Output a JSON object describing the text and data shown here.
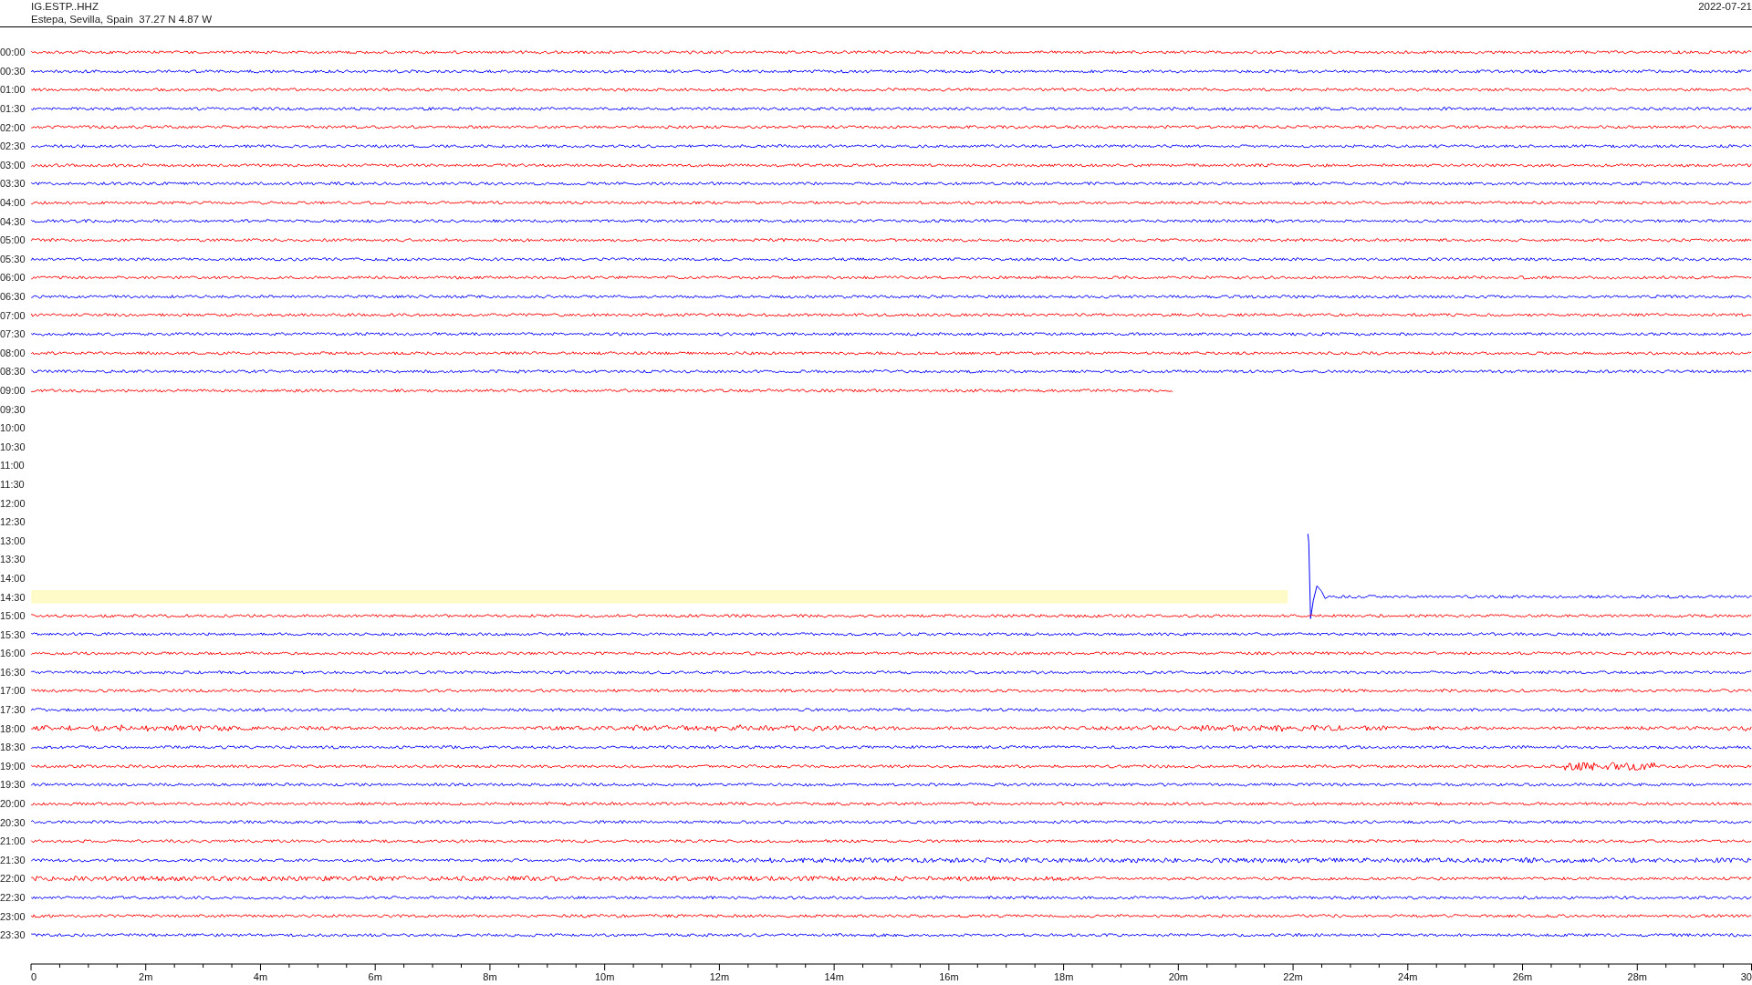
{
  "header": {
    "station": "IG.ESTP..HHZ",
    "location": "Estepa, Sevilla, Spain  37.27 N 4.87 W",
    "date": "2022-07-21"
  },
  "rows": [
    {
      "time": "00:00",
      "kind": "full",
      "color": "#ff0000",
      "highlighted": false
    },
    {
      "time": "00:30",
      "kind": "full",
      "color": "#0000ff",
      "highlighted": false
    },
    {
      "time": "01:00",
      "kind": "full",
      "color": "#ff0000",
      "highlighted": false
    },
    {
      "time": "01:30",
      "kind": "full",
      "color": "#0000ff",
      "highlighted": false
    },
    {
      "time": "02:00",
      "kind": "full",
      "color": "#ff0000",
      "highlighted": false
    },
    {
      "time": "02:30",
      "kind": "full",
      "color": "#0000ff",
      "highlighted": false
    },
    {
      "time": "03:00",
      "kind": "full",
      "color": "#ff0000",
      "highlighted": false
    },
    {
      "time": "03:30",
      "kind": "full",
      "color": "#0000ff",
      "highlighted": false
    },
    {
      "time": "04:00",
      "kind": "full",
      "color": "#ff0000",
      "highlighted": false
    },
    {
      "time": "04:30",
      "kind": "full",
      "color": "#0000ff",
      "highlighted": false
    },
    {
      "time": "05:00",
      "kind": "full",
      "color": "#ff0000",
      "highlighted": false
    },
    {
      "time": "05:30",
      "kind": "full",
      "color": "#0000ff",
      "highlighted": false
    },
    {
      "time": "06:00",
      "kind": "full",
      "color": "#ff0000",
      "highlighted": false
    },
    {
      "time": "06:30",
      "kind": "full",
      "color": "#0000ff",
      "highlighted": false
    },
    {
      "time": "07:00",
      "kind": "full",
      "color": "#ff0000",
      "highlighted": false
    },
    {
      "time": "07:30",
      "kind": "full",
      "color": "#0000ff",
      "highlighted": false
    },
    {
      "time": "08:00",
      "kind": "full",
      "color": "#ff0000",
      "highlighted": false
    },
    {
      "time": "08:30",
      "kind": "full",
      "color": "#0000ff",
      "highlighted": false
    },
    {
      "time": "09:00",
      "kind": "ends",
      "color": "#ff0000",
      "level": 0.664,
      "highlighted": false
    },
    {
      "time": "09:30",
      "kind": "empty",
      "highlighted": false
    },
    {
      "time": "10:00",
      "kind": "empty",
      "highlighted": false
    },
    {
      "time": "10:30",
      "kind": "empty",
      "highlighted": false
    },
    {
      "time": "11:00",
      "kind": "empty",
      "highlighted": false
    },
    {
      "time": "11:30",
      "kind": "empty",
      "highlighted": false
    },
    {
      "time": "12:00",
      "kind": "empty",
      "highlighted": false
    },
    {
      "time": "12:30",
      "kind": "empty",
      "highlighted": false
    },
    {
      "time": "13:00",
      "kind": "empty",
      "highlighted": false
    },
    {
      "time": "13:30",
      "kind": "empty",
      "highlighted": false
    },
    {
      "time": "14:00",
      "kind": "empty",
      "highlighted": false
    },
    {
      "time": "14:30",
      "kind": "starts",
      "color": "#0000ff",
      "level": 0.258,
      "highlighted": true
    },
    {
      "time": "15:00",
      "kind": "full",
      "color": "#ff0000",
      "highlighted": false
    },
    {
      "time": "15:30",
      "kind": "full",
      "color": "#0000ff",
      "highlighted": false
    },
    {
      "time": "16:00",
      "kind": "full",
      "color": "#ff0000",
      "highlighted": false
    },
    {
      "time": "16:30",
      "kind": "full",
      "color": "#0000ff",
      "highlighted": false
    },
    {
      "time": "17:00",
      "kind": "full",
      "color": "#ff0000",
      "highlighted": false
    },
    {
      "time": "17:30",
      "kind": "full",
      "color": "#0000ff",
      "highlighted": false
    },
    {
      "time": "18:00",
      "kind": "full",
      "color": "#ff0000",
      "highlighted": false
    },
    {
      "time": "18:30",
      "kind": "full",
      "color": "#0000ff",
      "highlighted": false
    },
    {
      "time": "19:00",
      "kind": "full",
      "color": "#ff0000",
      "highlighted": false
    },
    {
      "time": "19:30",
      "kind": "full",
      "color": "#0000ff",
      "highlighted": false
    },
    {
      "time": "20:00",
      "kind": "full",
      "color": "#ff0000",
      "highlighted": false
    },
    {
      "time": "20:30",
      "kind": "full",
      "color": "#0000ff",
      "highlighted": false
    },
    {
      "time": "21:00",
      "kind": "full",
      "color": "#ff0000",
      "highlighted": false
    },
    {
      "time": "21:30",
      "kind": "full",
      "color": "#0000ff",
      "highlighted": false
    },
    {
      "time": "22:00",
      "kind": "full",
      "color": "#ff0000",
      "highlighted": false
    },
    {
      "time": "22:30",
      "kind": "full",
      "color": "#0000ff",
      "highlighted": false
    },
    {
      "time": "23:00",
      "kind": "full",
      "color": "#ff0000",
      "highlighted": false
    },
    {
      "time": "23:30",
      "kind": "full",
      "color": "#0000ff",
      "highlighted": false
    }
  ],
  "x_axis": {
    "labels": [
      "0",
      "2m",
      "4m",
      "6m",
      "8m",
      "10m",
      "12m",
      "14m",
      "16m",
      "18m",
      "20m",
      "22m",
      "24m",
      "26m",
      "28m",
      "30"
    ]
  }
}
